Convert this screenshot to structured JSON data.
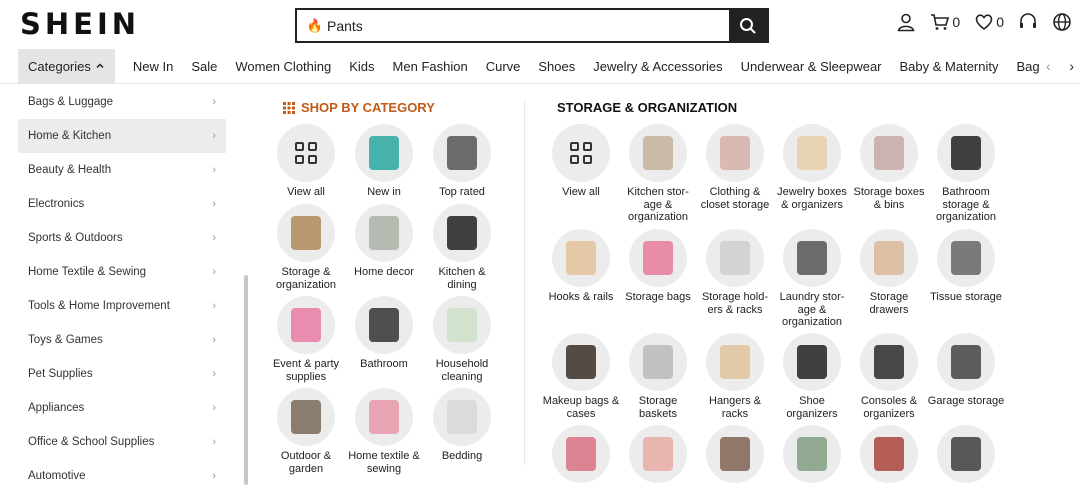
{
  "brand": "SHEIN",
  "search": {
    "value": "Pants"
  },
  "header": {
    "cart_count": "0",
    "wishlist_count": "0"
  },
  "nav": {
    "categories_label": "Categories",
    "items": [
      "New In",
      "Sale",
      "Women Clothing",
      "Kids",
      "Men Fashion",
      "Curve",
      "Shoes",
      "Jewelry & Accessories",
      "Underwear & Sleepwear",
      "Baby & Maternity",
      "Bags & Luggage"
    ]
  },
  "sidebar": {
    "items": [
      "Bags & Luggage",
      "Home & Kitchen",
      "Beauty & Health",
      "Electronics",
      "Sports & Outdoors",
      "Home Textile & Sewing",
      "Tools & Home Improvement",
      "Toys & Games",
      "Pet Supplies",
      "Appliances",
      "Office & School Supplies",
      "Automotive"
    ],
    "active": "Home & Kitchen"
  },
  "shop_by_category": {
    "title": "SHOP BY CATEGORY",
    "tiles": [
      "View all",
      "New in",
      "Top rated",
      "Storage & organization",
      "Home decor",
      "Kitchen & dining",
      "Event & party supplies",
      "Bathroom",
      "Household cleaning",
      "Outdoor & garden",
      "Home textile & sewing",
      "Bedding"
    ]
  },
  "storage": {
    "title": "STORAGE & ORGANIZATION",
    "tiles": [
      "View all",
      "Kitchen stor- age & organization",
      "Clothing & closet storage",
      "Jewelry boxes & organizers",
      "Storage boxes & bins",
      "Bathroom storage & organization",
      "Hooks & rails",
      "Storage bags",
      "Storage hold- ers & racks",
      "Laundry stor- age & organization",
      "Storage drawers",
      "Tissue storage",
      "Makeup bags & cases",
      "Storage baskets",
      "Hangers & racks",
      "Shoe organizers",
      "Consoles & organizers",
      "Garage storage"
    ]
  },
  "colors": {
    "accent": "#c25a16",
    "active_bg": "#ececec",
    "primary": "#222222"
  }
}
